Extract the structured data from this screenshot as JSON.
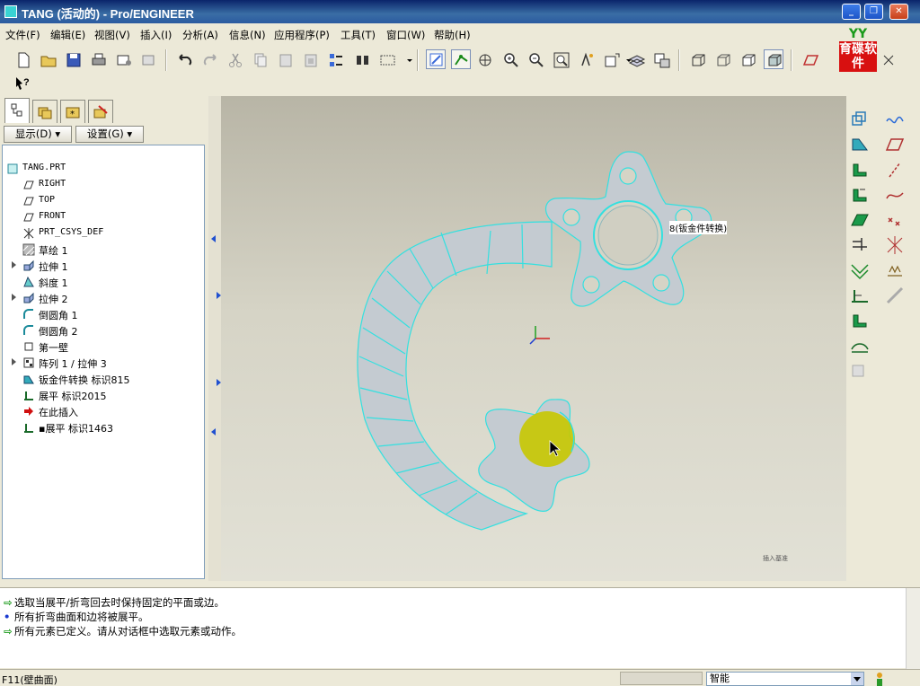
{
  "window": {
    "title": "TANG (活动的) - Pro/ENGINEER",
    "min_label": "_",
    "max_label": "❐",
    "close_label": "✕"
  },
  "menu": [
    {
      "label": "文件(F)"
    },
    {
      "label": "编辑(E)"
    },
    {
      "label": "视图(V)"
    },
    {
      "label": "插入(I)"
    },
    {
      "label": "分析(A)"
    },
    {
      "label": "信息(N)"
    },
    {
      "label": "应用程序(P)"
    },
    {
      "label": "工具(T)"
    },
    {
      "label": "窗口(W)"
    },
    {
      "label": "帮助(H)"
    }
  ],
  "logo": {
    "top": "YY",
    "text": "育碟软件"
  },
  "panel": {
    "show_label": "显示(D) ▾",
    "settings_label": "设置(G) ▾",
    "tree": [
      {
        "label": "TANG.PRT",
        "icon": "part-icon"
      },
      {
        "label": "RIGHT",
        "icon": "datum-plane-icon"
      },
      {
        "label": "TOP",
        "icon": "datum-plane-icon"
      },
      {
        "label": "FRONT",
        "icon": "datum-plane-icon"
      },
      {
        "label": "PRT_CSYS_DEF",
        "icon": "csys-icon"
      },
      {
        "label": "草绘 1",
        "icon": "sketch-icon"
      },
      {
        "label": "拉伸 1",
        "icon": "extrude-icon"
      },
      {
        "label": "斜度 1",
        "icon": "draft-icon"
      },
      {
        "label": "拉伸 2",
        "icon": "extrude-icon"
      },
      {
        "label": "倒圆角 1",
        "icon": "round-icon"
      },
      {
        "label": "倒圆角 2",
        "icon": "round-icon"
      },
      {
        "label": "第一壁",
        "icon": "wall-icon"
      },
      {
        "label": "阵列 1 / 拉伸 3",
        "icon": "pattern-icon"
      },
      {
        "label": "钣金件转换 标识815",
        "icon": "sheetmetal-convert-icon"
      },
      {
        "label": "展平 标识2015",
        "icon": "unbend-icon"
      },
      {
        "label": "在此插入",
        "icon": "insert-here-icon"
      },
      {
        "label": "▪展平 标识1463",
        "icon": "unbend-icon"
      }
    ]
  },
  "viewport": {
    "part_label": "8(钣金件转换)",
    "corner_note": "插入基准"
  },
  "messages": [
    {
      "text": "选取当展平/折弯回去时保持固定的平面或边。",
      "kind": "prompt"
    },
    {
      "text": "所有折弯曲面和边将被展平。",
      "kind": "info"
    },
    {
      "text": "所有元素已定义。请从对话框中选取元素或动作。",
      "kind": "prompt"
    }
  ],
  "status": {
    "text": "F11(壁曲面)",
    "filter_value": "智能"
  },
  "colors": {
    "edge": "#33e0e0",
    "face": "#c4cbd1",
    "highlight": "#c8c800"
  }
}
